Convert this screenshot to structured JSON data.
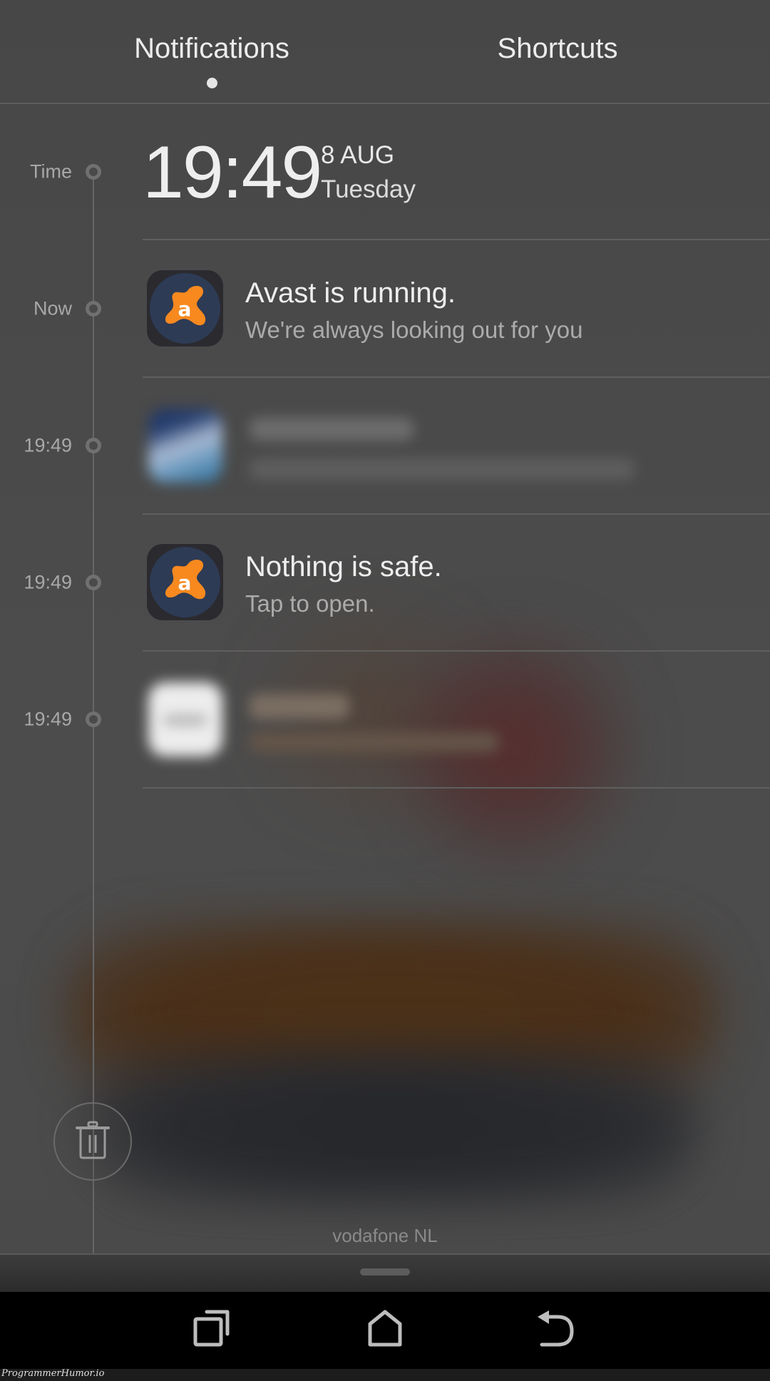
{
  "tabs": {
    "items": [
      {
        "label": "Notifications",
        "active": true
      },
      {
        "label": "Shortcuts",
        "active": false
      }
    ]
  },
  "header": {
    "time_label": "Time",
    "clock": "19:49",
    "date": "8 AUG",
    "weekday": "Tuesday"
  },
  "notifications": [
    {
      "timeline_label": "Now",
      "app_icon": "avast-icon",
      "title": "Avast is running.",
      "text": "We're always looking out for you",
      "blurred": false
    },
    {
      "timeline_label": "19:49",
      "app_icon": "blurred-app-icon",
      "title": "",
      "text": "",
      "blurred": true
    },
    {
      "timeline_label": "19:49",
      "app_icon": "avast-icon",
      "title": "Nothing is safe.",
      "text": "Tap to open.",
      "blurred": false
    },
    {
      "timeline_label": "19:49",
      "app_icon": "blurred-app-icon",
      "title": "",
      "text": "",
      "blurred": true
    }
  ],
  "actions": {
    "clear_all_icon": "trash-icon"
  },
  "status": {
    "carrier": "vodafone NL"
  },
  "navbar": {
    "buttons": [
      {
        "name": "recent-apps",
        "icon": "recent-apps-icon"
      },
      {
        "name": "home",
        "icon": "home-icon"
      },
      {
        "name": "back",
        "icon": "back-icon"
      }
    ]
  },
  "watermark": "ProgrammerHumor.io",
  "colors": {
    "avast_orange": "#f7891f",
    "avast_disc": "#2d3b55",
    "background": "#4a4a4a",
    "navbar": "#000000"
  }
}
